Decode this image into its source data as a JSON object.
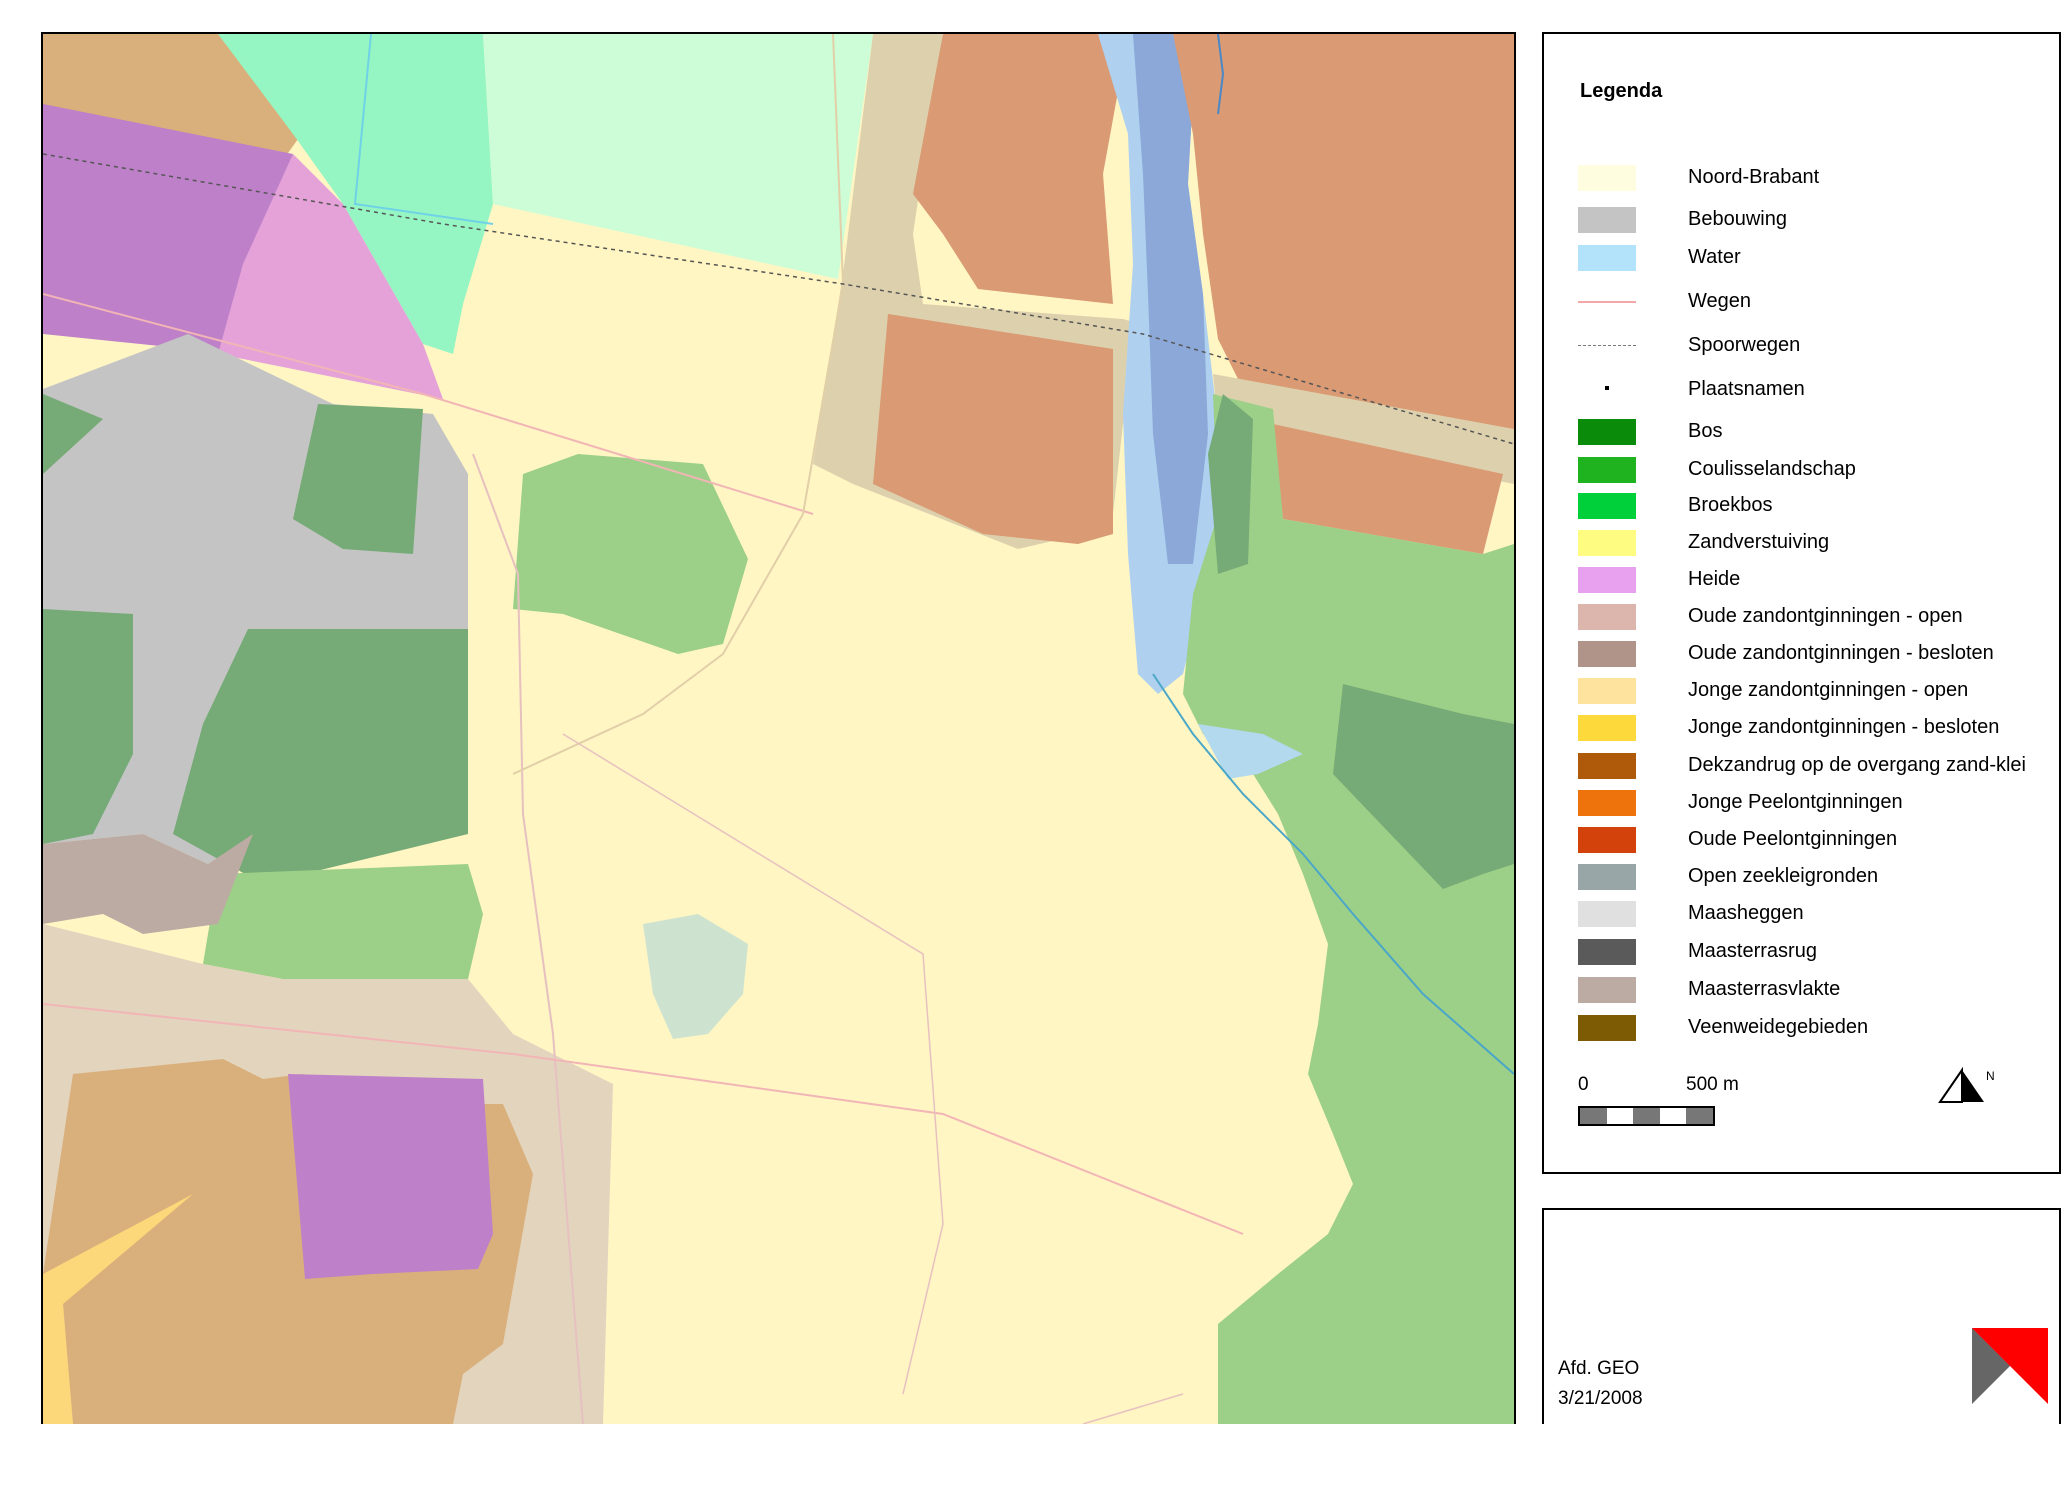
{
  "legend": {
    "title": "Legenda",
    "items": [
      {
        "label": "Noord-Brabant",
        "type": "fill",
        "color": "#fffde0"
      },
      {
        "label": "Bebouwing",
        "type": "fill",
        "color": "#c4c4c4"
      },
      {
        "label": "Water",
        "type": "fill",
        "color": "#b3e2fb"
      },
      {
        "label": "Wegen",
        "type": "line",
        "color": "#f4a7a7"
      },
      {
        "label": "Spoorwegen",
        "type": "dash",
        "color": "#777777"
      },
      {
        "label": "Plaatsnamen",
        "type": "dot",
        "color": "#000000"
      },
      {
        "label": "Bos",
        "type": "fill",
        "color": "#0a8c0a"
      },
      {
        "label": "Coulisselandschap",
        "type": "fill",
        "color": "#1fb41f"
      },
      {
        "label": "Broekbos",
        "type": "fill",
        "color": "#00d13a"
      },
      {
        "label": "Zandverstuiving",
        "type": "fill",
        "color": "#fffc82"
      },
      {
        "label": "Heide",
        "type": "fill",
        "color": "#e8a1ee"
      },
      {
        "label": "Oude zandontginningen - open",
        "type": "fill",
        "color": "#dcb6ad"
      },
      {
        "label": "Oude zandontginningen - besloten",
        "type": "fill",
        "color": "#b09489"
      },
      {
        "label": "Jonge zandontginningen - open",
        "type": "fill",
        "color": "#fde39e"
      },
      {
        "label": "Jonge zandontginningen - besloten",
        "type": "fill",
        "color": "#fdd93c"
      },
      {
        "label": "Dekzandrug op de overgang zand-klei",
        "type": "fill",
        "color": "#ae5a0a"
      },
      {
        "label": "Jonge Peelontginningen",
        "type": "fill",
        "color": "#ee730c"
      },
      {
        "label": "Oude Peelontginningen",
        "type": "fill",
        "color": "#d2420a"
      },
      {
        "label": "Open zeekleigronden",
        "type": "fill",
        "color": "#98a6a8"
      },
      {
        "label": "Maasheggen",
        "type": "fill",
        "color": "#e0e0e0"
      },
      {
        "label": "Maasterrasrug",
        "type": "fill",
        "color": "#5a5a5a"
      },
      {
        "label": "Maasterrasvlakte",
        "type": "fill",
        "color": "#bcaba3"
      },
      {
        "label": "Veenweidegebieden",
        "type": "fill",
        "color": "#7d5b05"
      }
    ]
  },
  "scale": {
    "zero": "0",
    "max": "500 m"
  },
  "north": {
    "label": "N"
  },
  "footer": {
    "department": "Afd. GEO",
    "date": "3/21/2008"
  },
  "colors": {
    "logo_red": "#ff0000",
    "logo_gray": "#666666"
  }
}
